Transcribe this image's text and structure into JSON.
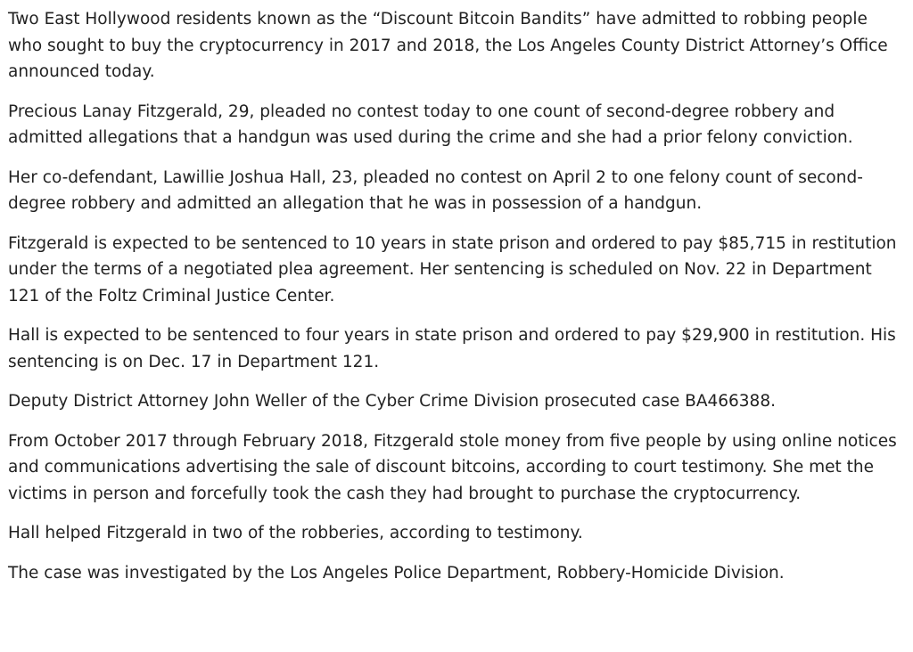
{
  "article": {
    "paragraphs": [
      "Two East Hollywood residents known as the “Discount Bitcoin Bandits” have admitted to robbing people who sought to buy the cryptocurrency in 2017 and 2018, the Los Angeles County District Attorney’s Office announced today.",
      "Precious Lanay Fitzgerald, 29, pleaded no contest today to one count of second-degree robbery and admitted allegations that a handgun was used during the crime and she had a prior felony conviction.",
      "Her co-defendant, Lawillie Joshua Hall, 23, pleaded no contest on April 2 to one felony count of second-degree robbery and admitted an allegation that he was in possession of a handgun.",
      "Fitzgerald is expected to be sentenced to 10 years in state prison and ordered to pay $85,715 in restitution under the terms of a negotiated plea agreement. Her sentencing is scheduled on Nov. 22 in Department 121 of the Foltz Criminal Justice Center.",
      "Hall is expected to be sentenced to four years in state prison and ordered to pay $29,900 in restitution. His sentencing is on Dec. 17 in Department 121.",
      "Deputy District Attorney John Weller of the Cyber Crime Division prosecuted case BA466388.",
      "From October 2017 through February 2018, Fitzgerald stole money from five people by using online notices and communications advertising the sale of discount bitcoins, according to court testimony. She met the victims in person and forcefully took the cash they had brought to purchase the cryptocurrency.",
      "Hall helped Fitzgerald in two of the robberies, according to testimony.",
      "The case was investigated by the Los Angeles Police Department, Robbery-Homicide Division."
    ]
  }
}
